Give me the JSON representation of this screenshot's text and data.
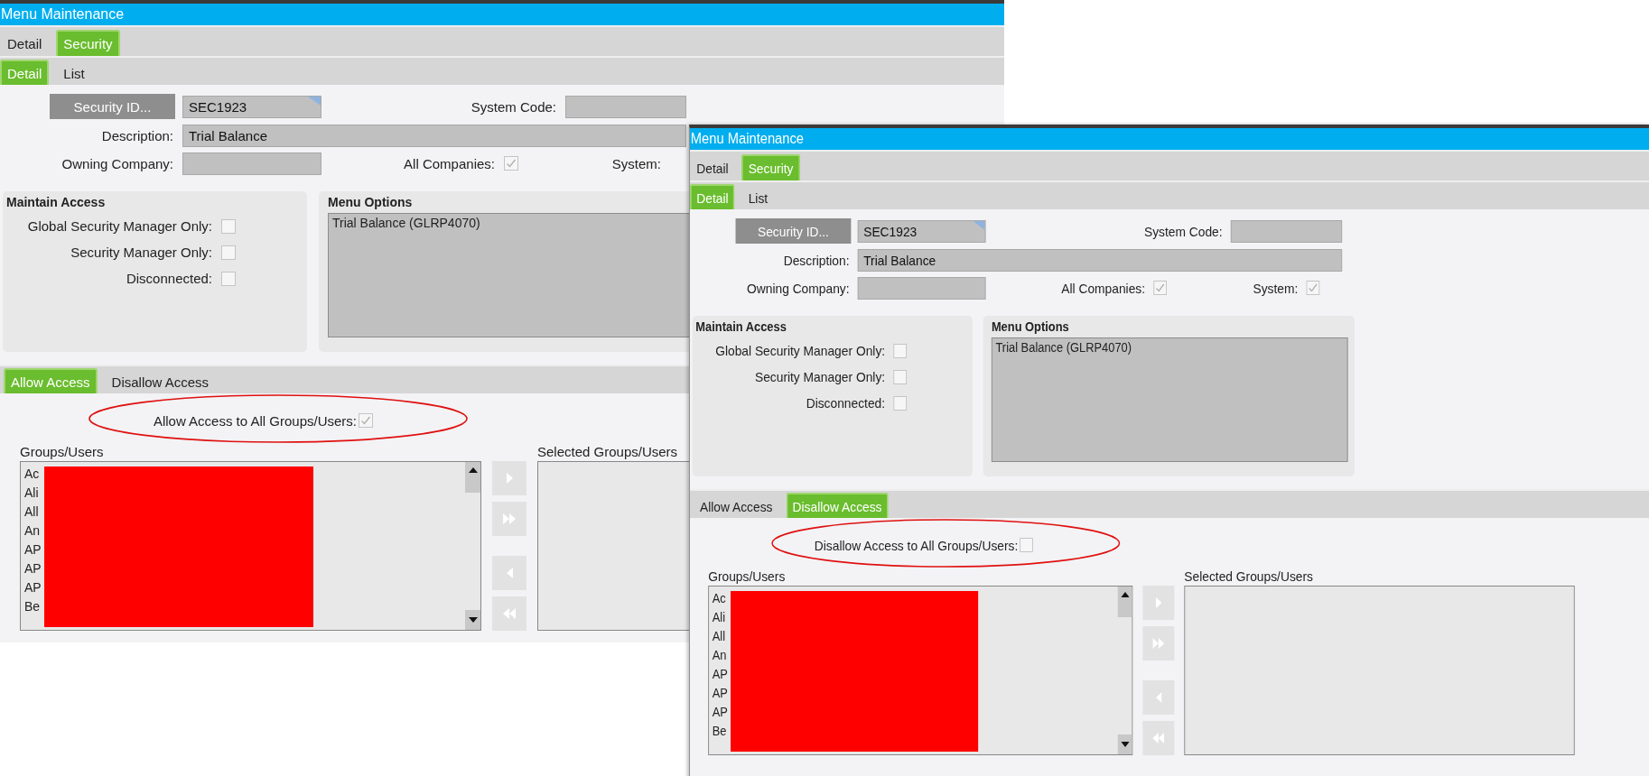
{
  "windows": [
    {
      "title": "Menu Maintenance",
      "tabs": [
        {
          "label": "Detail",
          "selected": false
        },
        {
          "label": "Security",
          "selected": true
        }
      ],
      "subtabs": [
        {
          "label": "Detail",
          "selected": true
        },
        {
          "label": "List",
          "selected": false
        }
      ],
      "security_id_button": "Security ID...",
      "security_id": "SEC1923",
      "system_code_label": "System Code:",
      "description_label": "Description:",
      "description": "Trial Balance",
      "owning_company_label": "Owning Company:",
      "all_companies": {
        "label": "All Companies:",
        "checked": true
      },
      "system": {
        "label": "System:"
      },
      "maintain_access": {
        "title": "Maintain Access",
        "options": [
          {
            "label": "Global Security Manager Only:",
            "checked": false
          },
          {
            "label": "Security Manager Only:",
            "checked": false
          },
          {
            "label": "Disconnected:",
            "checked": false
          }
        ]
      },
      "menu_options": {
        "title": "Menu Options",
        "items": [
          "Trial Balance (GLRP4070)"
        ]
      },
      "access_tabs": [
        {
          "label": "Allow Access",
          "selected": true
        },
        {
          "label": "Disallow Access",
          "selected": false
        }
      ],
      "access_all": {
        "label": "Allow Access to All Groups/Users:",
        "checked": true,
        "circled": true
      },
      "groups": {
        "label": "Groups/Users",
        "items": [
          "Ac",
          "Ali",
          "All",
          "An",
          "AP",
          "AP",
          "AP",
          "Be"
        ],
        "redacted": true
      },
      "selected_groups": {
        "label": "Selected Groups/Users"
      }
    },
    {
      "title": "Menu Maintenance",
      "tabs": [
        {
          "label": "Detail",
          "selected": false
        },
        {
          "label": "Security",
          "selected": true
        }
      ],
      "subtabs": [
        {
          "label": "Detail",
          "selected": true
        },
        {
          "label": "List",
          "selected": false
        }
      ],
      "security_id_button": "Security ID...",
      "security_id": "SEC1923",
      "system_code_label": "System Code:",
      "description_label": "Description:",
      "description": "Trial Balance",
      "owning_company_label": "Owning Company:",
      "all_companies": {
        "label": "All Companies:",
        "checked": true
      },
      "system": {
        "label": "System:",
        "checked": true
      },
      "maintain_access": {
        "title": "Maintain Access",
        "options": [
          {
            "label": "Global Security Manager Only:",
            "checked": false
          },
          {
            "label": "Security Manager Only:",
            "checked": false
          },
          {
            "label": "Disconnected:",
            "checked": false
          }
        ]
      },
      "menu_options": {
        "title": "Menu Options",
        "items": [
          "Trial Balance (GLRP4070)"
        ]
      },
      "access_tabs": [
        {
          "label": "Allow Access",
          "selected": false
        },
        {
          "label": "Disallow Access",
          "selected": true
        }
      ],
      "access_all": {
        "label": "Disallow Access to All Groups/Users:",
        "checked": false,
        "circled": true
      },
      "groups": {
        "label": "Groups/Users",
        "items": [
          "Ac",
          "Ali",
          "All",
          "An",
          "AP",
          "AP",
          "AP",
          "Be"
        ],
        "redacted": true
      },
      "selected_groups": {
        "label": "Selected Groups/Users"
      }
    }
  ]
}
